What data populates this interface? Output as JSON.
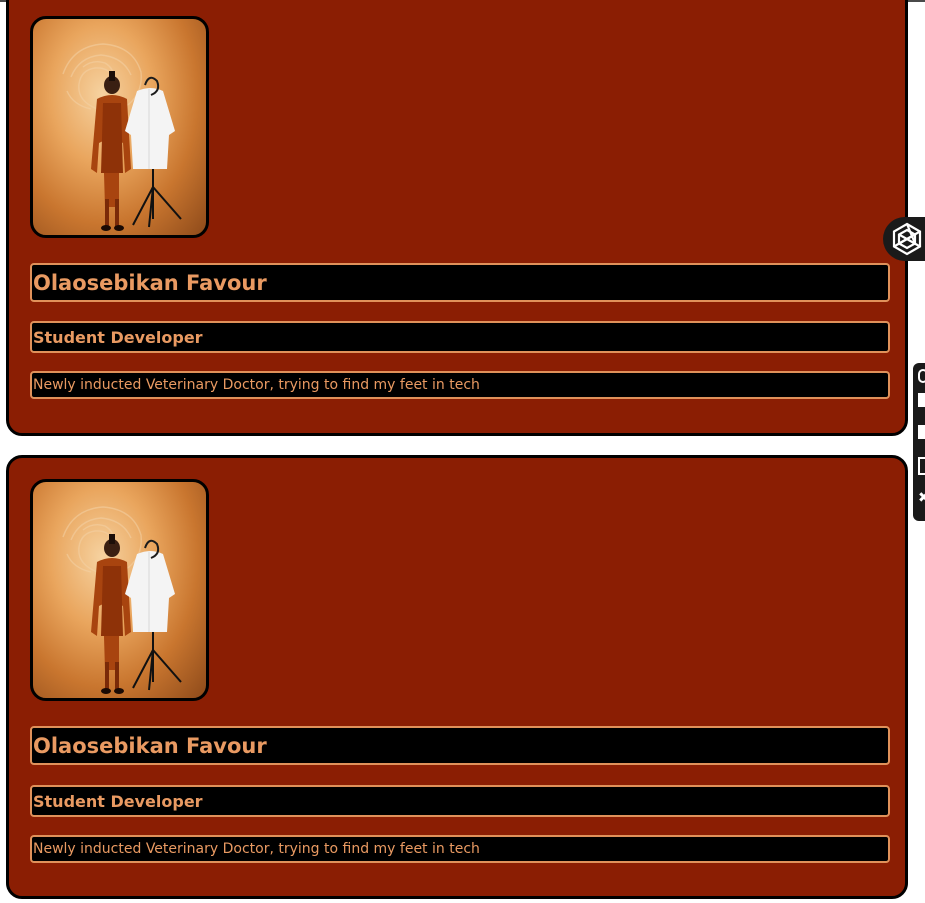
{
  "profiles": [
    {
      "name": "Olaosebikan Favour",
      "role": "Student Developer",
      "bio": "Newly inducted Veterinary Doctor, trying to find my feet in tech"
    },
    {
      "name": "Olaosebikan Favour",
      "role": "Student Developer",
      "bio": "Newly inducted Veterinary Doctor, trying to find my feet in tech"
    }
  ],
  "colors": {
    "card_background": "#8b1e03",
    "field_background": "#000000",
    "field_border": "#e0915a",
    "text_accent": "#e99a62"
  },
  "icons": {
    "floating_button": "openai-logo-icon",
    "toolbar": [
      "search-icon",
      "square-icon",
      "square-icon",
      "copy-icon",
      "close-icon"
    ]
  }
}
